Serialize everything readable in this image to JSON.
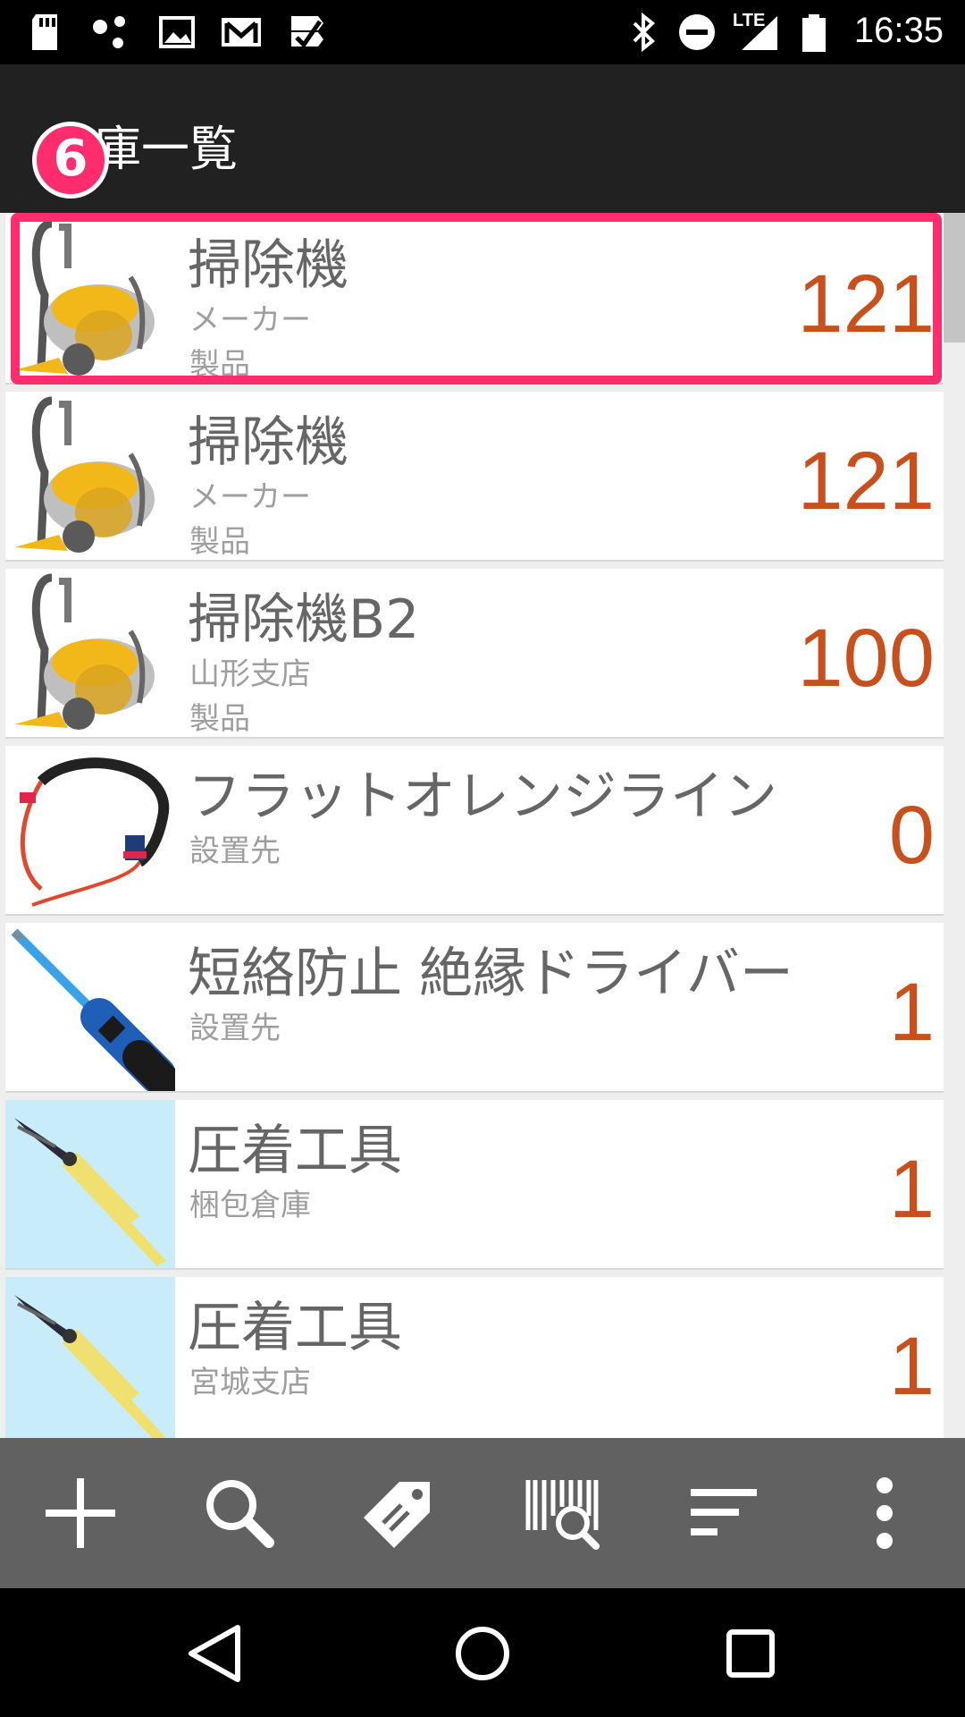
{
  "status_bar": {
    "time": "16:35",
    "network": "LTE",
    "left_icons": [
      "sd-card-icon",
      "dots-app-icon",
      "image-icon",
      "gmail-icon",
      "task-check-icon"
    ],
    "right_icons": [
      "bluetooth-icon",
      "do-not-disturb-icon",
      "signal-icon",
      "battery-icon"
    ]
  },
  "app_bar": {
    "title": "在庫一覧",
    "step_badge": "6"
  },
  "items": [
    {
      "name": "掃除機",
      "sub1": "メーカー",
      "sub2": "製品",
      "qty": "121",
      "thumb": "vacuum-cleaner"
    },
    {
      "name": "掃除機",
      "sub1": "メーカー",
      "sub2": "製品",
      "qty": "121",
      "thumb": "vacuum-cleaner"
    },
    {
      "name": "掃除機B2",
      "sub1": "山形支店",
      "sub2": "製品",
      "qty": "100",
      "thumb": "vacuum-cleaner"
    },
    {
      "name": "フラットオレンジライン",
      "sub1": "設置先",
      "sub2": "",
      "qty": "0",
      "thumb": "cable-line"
    },
    {
      "name": "短絡防止 絶縁ドライバー",
      "sub1": "設置先",
      "sub2": "",
      "qty": "1",
      "thumb": "screwdriver"
    },
    {
      "name": "圧着工具",
      "sub1": "梱包倉庫",
      "sub2": "",
      "qty": "1",
      "thumb": "crimping-tool"
    },
    {
      "name": "圧着工具",
      "sub1": "宮城支店",
      "sub2": "",
      "qty": "1",
      "thumb": "crimping-tool"
    }
  ],
  "toolbar": {
    "buttons": [
      "add-icon",
      "search-icon",
      "tag-edit-icon",
      "barcode-search-icon",
      "sort-icon",
      "more-vert-icon"
    ]
  },
  "nav": {
    "buttons": [
      "back-icon",
      "home-icon",
      "recents-icon"
    ]
  },
  "colors": {
    "accent_highlight": "#ff2d6e",
    "quantity": "#c8501c",
    "app_bar": "#212121",
    "toolbar": "#616161"
  }
}
